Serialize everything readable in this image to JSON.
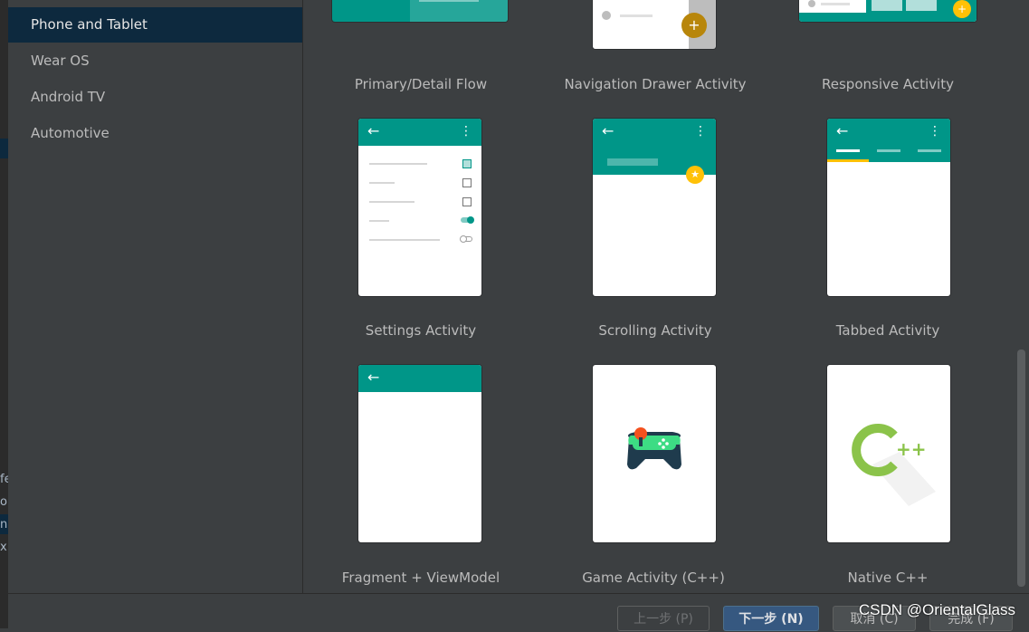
{
  "background_ide": {
    "fragments": [
      "fe",
      "o",
      "n",
      "x"
    ]
  },
  "sidebar": {
    "items": [
      {
        "label": "Phone and Tablet",
        "selected": true
      },
      {
        "label": "Wear OS",
        "selected": false
      },
      {
        "label": "Android TV",
        "selected": false
      },
      {
        "label": "Automotive",
        "selected": false
      }
    ]
  },
  "templates": [
    {
      "label": "Primary/Detail Flow"
    },
    {
      "label": "Navigation Drawer Activity"
    },
    {
      "label": "Responsive Activity"
    },
    {
      "label": "Settings Activity"
    },
    {
      "label": "Scrolling Activity"
    },
    {
      "label": "Tabbed Activity"
    },
    {
      "label": "Fragment + ViewModel"
    },
    {
      "label": "Game Activity (C++)"
    },
    {
      "label": "Native C++"
    }
  ],
  "footer": {
    "prev_label": "上一步 (P)",
    "next_label": "下一步 (N)",
    "cancel_label": "取消 (C)",
    "finish_label": "完成 (F)"
  },
  "watermark": "CSDN @OrientalGlass",
  "colors": {
    "accent_teal": "#009688",
    "selection": "#0d293e",
    "fab_yellow": "#ffc107",
    "primary_button": "#365880"
  }
}
